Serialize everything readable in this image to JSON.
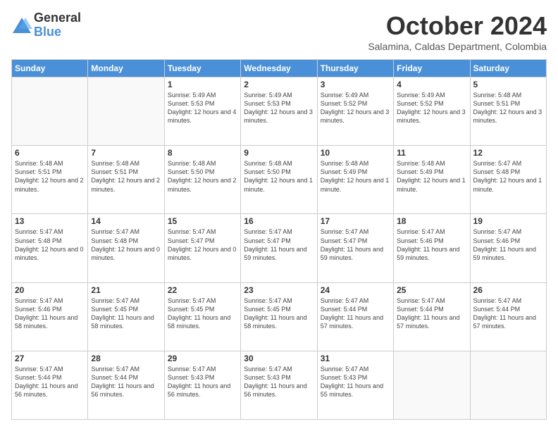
{
  "logo": {
    "general": "General",
    "blue": "Blue"
  },
  "header": {
    "month": "October 2024",
    "subtitle": "Salamina, Caldas Department, Colombia"
  },
  "weekdays": [
    "Sunday",
    "Monday",
    "Tuesday",
    "Wednesday",
    "Thursday",
    "Friday",
    "Saturday"
  ],
  "weeks": [
    [
      {
        "day": "",
        "sunrise": "",
        "sunset": "",
        "daylight": ""
      },
      {
        "day": "",
        "sunrise": "",
        "sunset": "",
        "daylight": ""
      },
      {
        "day": "1",
        "sunrise": "Sunrise: 5:49 AM",
        "sunset": "Sunset: 5:53 PM",
        "daylight": "Daylight: 12 hours and 4 minutes."
      },
      {
        "day": "2",
        "sunrise": "Sunrise: 5:49 AM",
        "sunset": "Sunset: 5:53 PM",
        "daylight": "Daylight: 12 hours and 3 minutes."
      },
      {
        "day": "3",
        "sunrise": "Sunrise: 5:49 AM",
        "sunset": "Sunset: 5:52 PM",
        "daylight": "Daylight: 12 hours and 3 minutes."
      },
      {
        "day": "4",
        "sunrise": "Sunrise: 5:49 AM",
        "sunset": "Sunset: 5:52 PM",
        "daylight": "Daylight: 12 hours and 3 minutes."
      },
      {
        "day": "5",
        "sunrise": "Sunrise: 5:48 AM",
        "sunset": "Sunset: 5:51 PM",
        "daylight": "Daylight: 12 hours and 3 minutes."
      }
    ],
    [
      {
        "day": "6",
        "sunrise": "Sunrise: 5:48 AM",
        "sunset": "Sunset: 5:51 PM",
        "daylight": "Daylight: 12 hours and 2 minutes."
      },
      {
        "day": "7",
        "sunrise": "Sunrise: 5:48 AM",
        "sunset": "Sunset: 5:51 PM",
        "daylight": "Daylight: 12 hours and 2 minutes."
      },
      {
        "day": "8",
        "sunrise": "Sunrise: 5:48 AM",
        "sunset": "Sunset: 5:50 PM",
        "daylight": "Daylight: 12 hours and 2 minutes."
      },
      {
        "day": "9",
        "sunrise": "Sunrise: 5:48 AM",
        "sunset": "Sunset: 5:50 PM",
        "daylight": "Daylight: 12 hours and 1 minute."
      },
      {
        "day": "10",
        "sunrise": "Sunrise: 5:48 AM",
        "sunset": "Sunset: 5:49 PM",
        "daylight": "Daylight: 12 hours and 1 minute."
      },
      {
        "day": "11",
        "sunrise": "Sunrise: 5:48 AM",
        "sunset": "Sunset: 5:49 PM",
        "daylight": "Daylight: 12 hours and 1 minute."
      },
      {
        "day": "12",
        "sunrise": "Sunrise: 5:47 AM",
        "sunset": "Sunset: 5:48 PM",
        "daylight": "Daylight: 12 hours and 1 minute."
      }
    ],
    [
      {
        "day": "13",
        "sunrise": "Sunrise: 5:47 AM",
        "sunset": "Sunset: 5:48 PM",
        "daylight": "Daylight: 12 hours and 0 minutes."
      },
      {
        "day": "14",
        "sunrise": "Sunrise: 5:47 AM",
        "sunset": "Sunset: 5:48 PM",
        "daylight": "Daylight: 12 hours and 0 minutes."
      },
      {
        "day": "15",
        "sunrise": "Sunrise: 5:47 AM",
        "sunset": "Sunset: 5:47 PM",
        "daylight": "Daylight: 12 hours and 0 minutes."
      },
      {
        "day": "16",
        "sunrise": "Sunrise: 5:47 AM",
        "sunset": "Sunset: 5:47 PM",
        "daylight": "Daylight: 11 hours and 59 minutes."
      },
      {
        "day": "17",
        "sunrise": "Sunrise: 5:47 AM",
        "sunset": "Sunset: 5:47 PM",
        "daylight": "Daylight: 11 hours and 59 minutes."
      },
      {
        "day": "18",
        "sunrise": "Sunrise: 5:47 AM",
        "sunset": "Sunset: 5:46 PM",
        "daylight": "Daylight: 11 hours and 59 minutes."
      },
      {
        "day": "19",
        "sunrise": "Sunrise: 5:47 AM",
        "sunset": "Sunset: 5:46 PM",
        "daylight": "Daylight: 11 hours and 59 minutes."
      }
    ],
    [
      {
        "day": "20",
        "sunrise": "Sunrise: 5:47 AM",
        "sunset": "Sunset: 5:46 PM",
        "daylight": "Daylight: 11 hours and 58 minutes."
      },
      {
        "day": "21",
        "sunrise": "Sunrise: 5:47 AM",
        "sunset": "Sunset: 5:45 PM",
        "daylight": "Daylight: 11 hours and 58 minutes."
      },
      {
        "day": "22",
        "sunrise": "Sunrise: 5:47 AM",
        "sunset": "Sunset: 5:45 PM",
        "daylight": "Daylight: 11 hours and 58 minutes."
      },
      {
        "day": "23",
        "sunrise": "Sunrise: 5:47 AM",
        "sunset": "Sunset: 5:45 PM",
        "daylight": "Daylight: 11 hours and 58 minutes."
      },
      {
        "day": "24",
        "sunrise": "Sunrise: 5:47 AM",
        "sunset": "Sunset: 5:44 PM",
        "daylight": "Daylight: 11 hours and 57 minutes."
      },
      {
        "day": "25",
        "sunrise": "Sunrise: 5:47 AM",
        "sunset": "Sunset: 5:44 PM",
        "daylight": "Daylight: 11 hours and 57 minutes."
      },
      {
        "day": "26",
        "sunrise": "Sunrise: 5:47 AM",
        "sunset": "Sunset: 5:44 PM",
        "daylight": "Daylight: 11 hours and 57 minutes."
      }
    ],
    [
      {
        "day": "27",
        "sunrise": "Sunrise: 5:47 AM",
        "sunset": "Sunset: 5:44 PM",
        "daylight": "Daylight: 11 hours and 56 minutes."
      },
      {
        "day": "28",
        "sunrise": "Sunrise: 5:47 AM",
        "sunset": "Sunset: 5:44 PM",
        "daylight": "Daylight: 11 hours and 56 minutes."
      },
      {
        "day": "29",
        "sunrise": "Sunrise: 5:47 AM",
        "sunset": "Sunset: 5:43 PM",
        "daylight": "Daylight: 11 hours and 56 minutes."
      },
      {
        "day": "30",
        "sunrise": "Sunrise: 5:47 AM",
        "sunset": "Sunset: 5:43 PM",
        "daylight": "Daylight: 11 hours and 56 minutes."
      },
      {
        "day": "31",
        "sunrise": "Sunrise: 5:47 AM",
        "sunset": "Sunset: 5:43 PM",
        "daylight": "Daylight: 11 hours and 55 minutes."
      },
      {
        "day": "",
        "sunrise": "",
        "sunset": "",
        "daylight": ""
      },
      {
        "day": "",
        "sunrise": "",
        "sunset": "",
        "daylight": ""
      }
    ]
  ]
}
